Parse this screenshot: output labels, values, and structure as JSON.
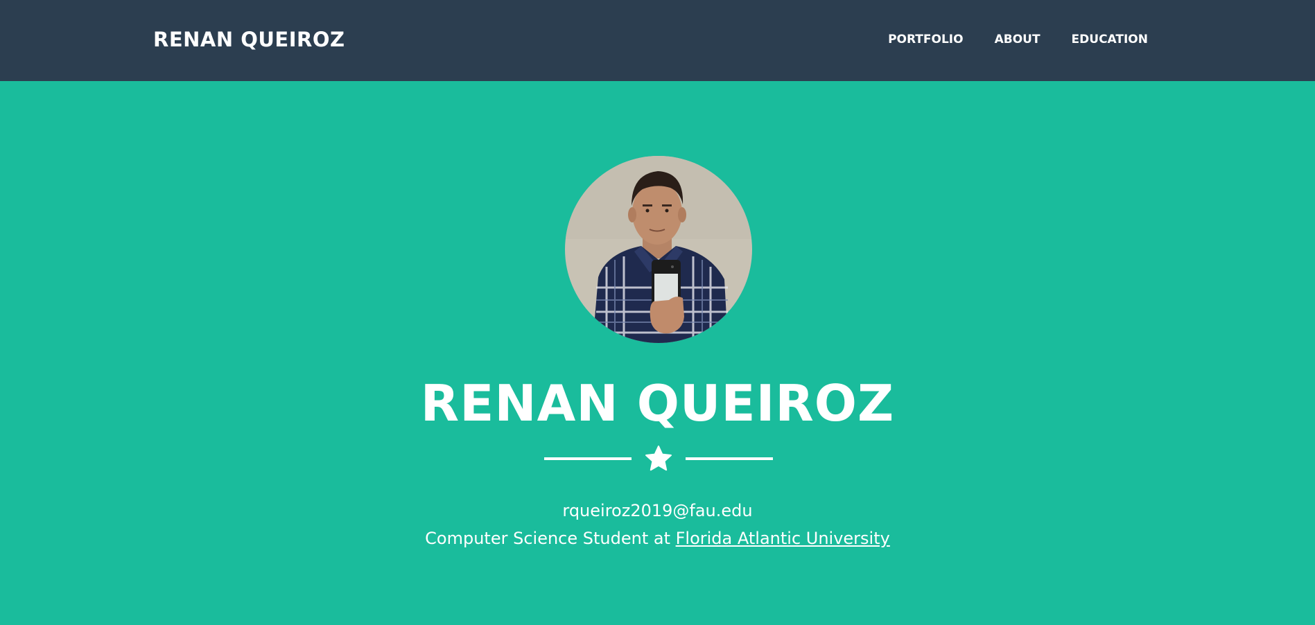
{
  "navbar": {
    "brand": "RENAN QUEIROZ",
    "links": [
      "PORTFOLIO",
      "ABOUT",
      "EDUCATION"
    ]
  },
  "hero": {
    "avatar_alt": "Profile photo",
    "title": "RENAN QUEIROZ",
    "divider_icon": "star-icon",
    "email": "rqueiroz2019@fau.edu",
    "subtitle_prefix": "Computer Science Student at ",
    "university_link": "Florida Atlantic University"
  },
  "colors": {
    "navbar_bg": "#2c3e50",
    "hero_bg": "#1abc9c",
    "text": "#ffffff"
  }
}
